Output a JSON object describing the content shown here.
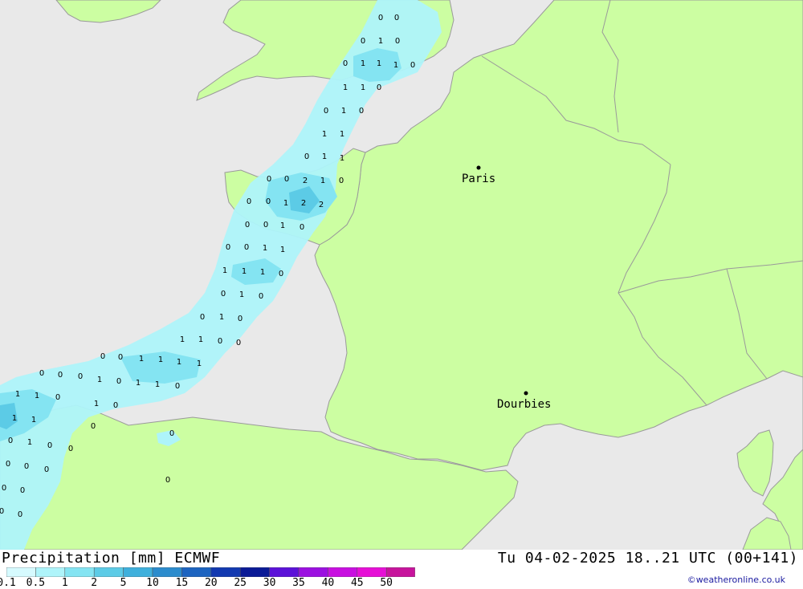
{
  "title": {
    "left": "Precipitation [mm] ECMWF",
    "right": "Tu 04-02-2025 18..21 UTC (00+141)"
  },
  "credit": "©weatheronline.co.uk",
  "colors": {
    "sea": "#e9e9e9",
    "land": "#ccfea2",
    "border": "#9a9a9a",
    "precip_light": "#aef4fa",
    "precip_mid": "#84e4f2",
    "precip_strong": "#5ccbe6"
  },
  "cities": [
    {
      "name": "Paris"
    },
    {
      "name": "Dourbies"
    }
  ],
  "legend": {
    "ticks": [
      "0.1",
      "0.5",
      "1",
      "2",
      "5",
      "10",
      "15",
      "20",
      "25",
      "30",
      "35",
      "40",
      "45",
      "50"
    ],
    "colors": [
      "#d6fafe",
      "#aef4fa",
      "#84e4f2",
      "#5ccbe6",
      "#3fb0dc",
      "#2c8ccd",
      "#1d64c0",
      "#1239b0",
      "#0a1a96",
      "#5b12d8",
      "#9b10e0",
      "#c80fe0",
      "#e60fd6",
      "#c7149c"
    ]
  },
  "map_values": [
    "0",
    "0",
    "0",
    "1",
    "0",
    "0",
    "1",
    "1",
    "1",
    "0",
    "1",
    "1",
    "0",
    "0",
    "1",
    "0",
    "1",
    "1",
    "0",
    "1",
    "1",
    "0",
    "0",
    "2",
    "1",
    "0",
    "0",
    "0",
    "1",
    "2",
    "2",
    "0",
    "0",
    "1",
    "0",
    "0",
    "0",
    "1",
    "1",
    "1",
    "1",
    "1",
    "0",
    "0",
    "1",
    "0",
    "0",
    "1",
    "0",
    "1",
    "1",
    "0",
    "0",
    "0",
    "0",
    "1",
    "1",
    "1",
    "1",
    "0",
    "0",
    "0",
    "1",
    "0",
    "1",
    "1",
    "0",
    "1",
    "1",
    "0",
    "1",
    "0",
    "1",
    "1",
    "0",
    "0",
    "1",
    "0",
    "0",
    "0",
    "0",
    "0",
    "0",
    "0",
    "0",
    "0",
    "0",
    "0"
  ]
}
